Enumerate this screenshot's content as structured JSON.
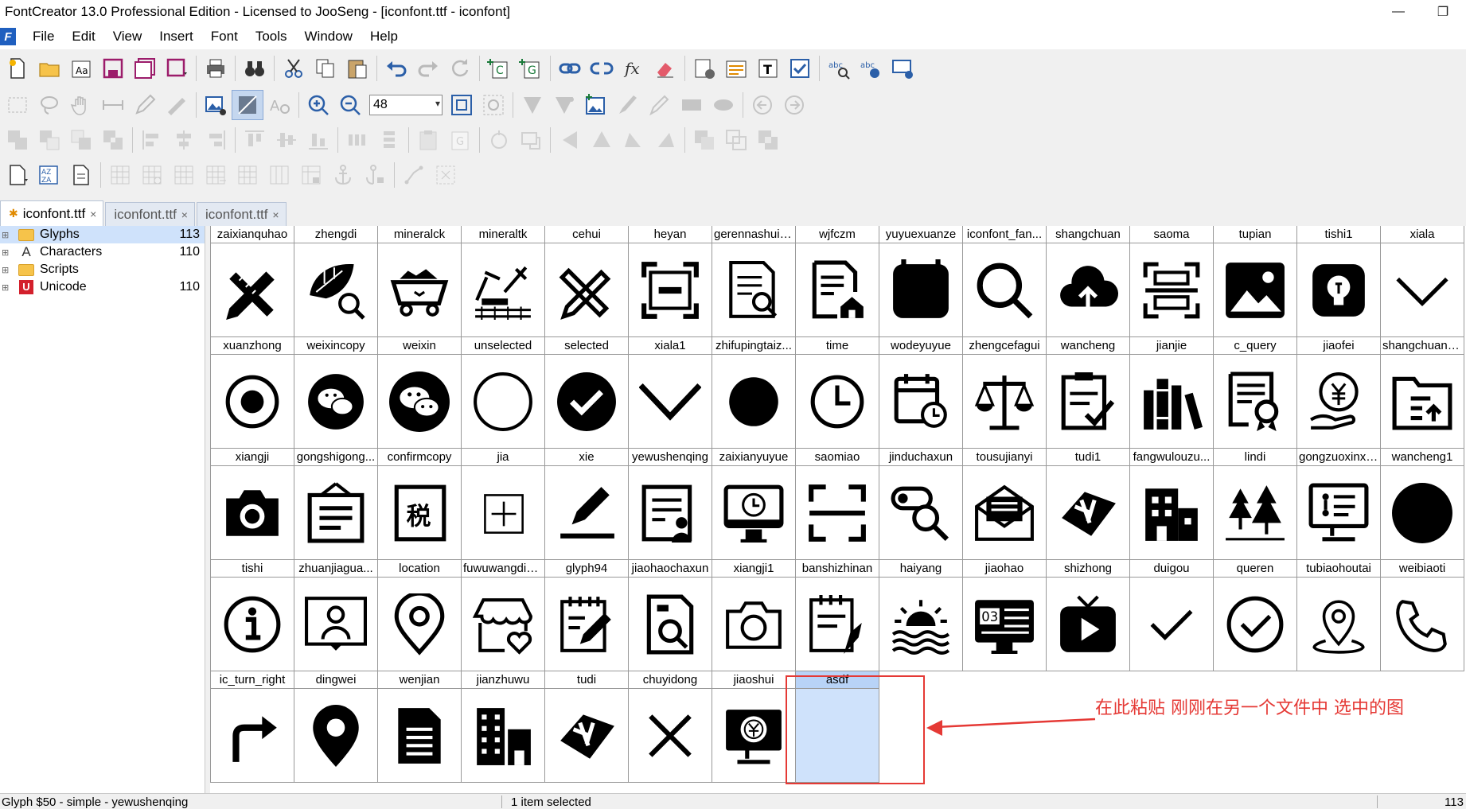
{
  "window": {
    "title": "FontCreator 13.0 Professional Edition - Licensed to JooSeng - [iconfont.ttf - iconfont]",
    "minimize_glyph": "—",
    "restore_glyph": "❐"
  },
  "menu": {
    "app_icon_letter": "F",
    "items": [
      "File",
      "Edit",
      "View",
      "Insert",
      "Font",
      "Tools",
      "Window",
      "Help"
    ]
  },
  "toolbar": {
    "zoom_value": "48"
  },
  "tabs": [
    {
      "label": "iconfont.ttf",
      "close": "×",
      "active": true
    },
    {
      "label": "iconfont.ttf",
      "close": "×",
      "active": false
    },
    {
      "label": "iconfont.ttf",
      "close": "×",
      "active": false
    }
  ],
  "tree": {
    "items": [
      {
        "label": "Glyphs",
        "count": "113",
        "icon": "folder-icon"
      },
      {
        "label": "Characters",
        "count": "110",
        "icon": "characters-icon"
      },
      {
        "label": "Scripts",
        "count": "",
        "icon": "folder-icon"
      },
      {
        "label": "Unicode",
        "count": "110",
        "icon": "unicode-icon"
      }
    ],
    "characters_glyph": "A",
    "unicode_glyph": "U"
  },
  "glyphs": [
    {
      "name": "zaixianquhao",
      "icon": "pencil-ruler"
    },
    {
      "name": "zhengdi",
      "icon": "leaf-search"
    },
    {
      "name": "mineralck",
      "icon": "mine-cart"
    },
    {
      "name": "mineraltk",
      "icon": "pickaxe-rail"
    },
    {
      "name": "cehui",
      "icon": "ruler-pencil"
    },
    {
      "name": "heyan",
      "icon": "scan-minus"
    },
    {
      "name": "gerennashuiz...",
      "icon": "doc-search"
    },
    {
      "name": "wjfczm",
      "icon": "doc-home"
    },
    {
      "name": "yuyuexuanze",
      "icon": "calendar-filled"
    },
    {
      "name": "iconfont_fan...",
      "icon": "magnifier"
    },
    {
      "name": "shangchuan",
      "icon": "cloud-upload"
    },
    {
      "name": "saoma",
      "icon": "scan-frame"
    },
    {
      "name": "tupian",
      "icon": "picture"
    },
    {
      "name": "tishi1",
      "icon": "bulb-badge"
    },
    {
      "name": "xiala",
      "icon": "chevron-down"
    },
    {
      "name": "xuanzhong",
      "icon": "radio-on"
    },
    {
      "name": "weixincopy",
      "icon": "wechat"
    },
    {
      "name": "weixin",
      "icon": "wechat-large"
    },
    {
      "name": "unselected",
      "icon": "circle-outline"
    },
    {
      "name": "selected",
      "icon": "check-circle-filled"
    },
    {
      "name": "xiala1",
      "icon": "chevron-down-large"
    },
    {
      "name": "zhifupingtaiz...",
      "icon": "dot-filled"
    },
    {
      "name": "time",
      "icon": "clock"
    },
    {
      "name": "wodeyuyue",
      "icon": "calendar-clock"
    },
    {
      "name": "zhengcefagui",
      "icon": "scales"
    },
    {
      "name": "wancheng",
      "icon": "clipboard-check"
    },
    {
      "name": "jianjie",
      "icon": "books"
    },
    {
      "name": "c_query",
      "icon": "certificate"
    },
    {
      "name": "jiaofei",
      "icon": "yen-hand"
    },
    {
      "name": "shangchuanz...",
      "icon": "folder-upload"
    },
    {
      "name": "xiangji",
      "icon": "camera-filled"
    },
    {
      "name": "gongshigong...",
      "icon": "notice-board"
    },
    {
      "name": "confirmcopy",
      "icon": "tax-stamp"
    },
    {
      "name": "jia",
      "icon": "plus-box"
    },
    {
      "name": "xie",
      "icon": "pen-line"
    },
    {
      "name": "yewushenqing",
      "icon": "doc-person"
    },
    {
      "name": "zaixianyuyue",
      "icon": "monitor-clock"
    },
    {
      "name": "saomiao",
      "icon": "scan-corners"
    },
    {
      "name": "jinduchaxun",
      "icon": "progress-search"
    },
    {
      "name": "tousujianyi",
      "icon": "mail-open"
    },
    {
      "name": "tudi1",
      "icon": "land-plot"
    },
    {
      "name": "fangwulouzu...",
      "icon": "building"
    },
    {
      "name": "lindi",
      "icon": "forest"
    },
    {
      "name": "gongzuoxinxi...",
      "icon": "monitor-list"
    },
    {
      "name": "wancheng1",
      "icon": "dot-large"
    },
    {
      "name": "tishi",
      "icon": "info-circle"
    },
    {
      "name": "zhuanjiagua...",
      "icon": "expert-screen"
    },
    {
      "name": "location",
      "icon": "pin-outline"
    },
    {
      "name": "fuwuwangdia...",
      "icon": "shop-heart"
    },
    {
      "name": "glyph94",
      "icon": "notepad-pen"
    },
    {
      "name": "jiaohaochaxun",
      "icon": "doc-magnifier"
    },
    {
      "name": "xiangji1",
      "icon": "camera-outline"
    },
    {
      "name": "banshizhinan",
      "icon": "clipboard-compass"
    },
    {
      "name": "haiyang",
      "icon": "sun-waves"
    },
    {
      "name": "jiaohao",
      "icon": "number-screen"
    },
    {
      "name": "shizhong",
      "icon": "tv-play"
    },
    {
      "name": "duigou",
      "icon": "checkmark"
    },
    {
      "name": "queren",
      "icon": "check-circle-outline"
    },
    {
      "name": "tubiaohoutai",
      "icon": "pin-map"
    },
    {
      "name": "weibiaoti",
      "icon": "phone"
    },
    {
      "name": "ic_turn_right",
      "icon": "turn-right"
    },
    {
      "name": "dingwei",
      "icon": "pin-filled"
    },
    {
      "name": "wenjian",
      "icon": "document-filled"
    },
    {
      "name": "jianzhuwu",
      "icon": "buildings"
    },
    {
      "name": "tudi",
      "icon": "land-plot"
    },
    {
      "name": "chuyidong",
      "icon": "close-x"
    },
    {
      "name": "jiaoshui",
      "icon": "monitor-yen"
    },
    {
      "name": "asdf",
      "icon": "",
      "selected": true
    }
  ],
  "annotation": {
    "text": "在此粘贴  刚刚在另一个文件中  选中的图",
    "color": "#e53935"
  },
  "status": {
    "left": "Glyph $50 - simple - yewushenqing",
    "middle": "1 item selected",
    "right": "113"
  }
}
